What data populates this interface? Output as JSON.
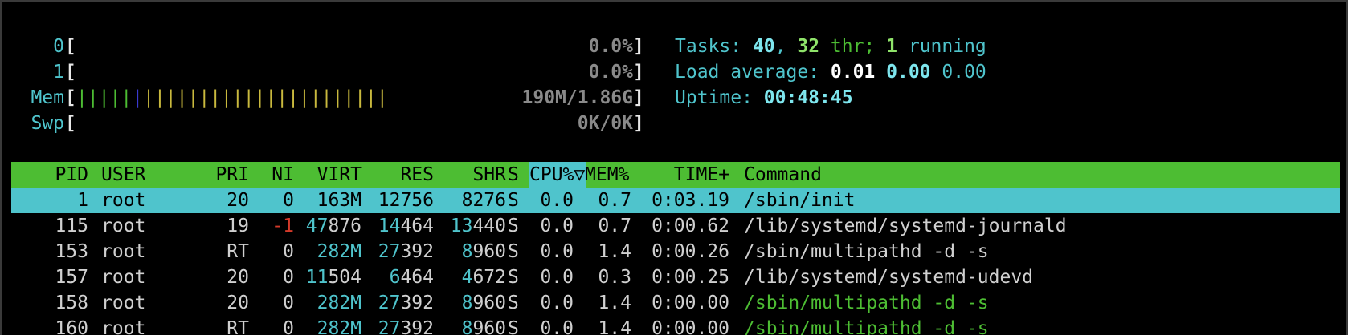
{
  "meters": {
    "cpu0": {
      "label": "0",
      "open": "[",
      "value": "0.0%",
      "close": "]"
    },
    "cpu1": {
      "label": "1",
      "open": "[",
      "value": "0.0%",
      "close": "]"
    },
    "mem": {
      "label": "Mem",
      "open": "[",
      "bars_green": "|||||",
      "bars_blue": "|",
      "bars_yellow": "||||||||||||||||||||||",
      "value": "190M/1.86G",
      "close": "]"
    },
    "swp": {
      "label": "Swp",
      "open": "[",
      "value": "0K/0K",
      "close": "]"
    }
  },
  "summary": {
    "tasks_label": "Tasks: ",
    "tasks_count": "40",
    "tasks_sep": ", ",
    "threads": "32",
    "threads_label": " thr; ",
    "running": "1",
    "running_label": " running",
    "load_label": "Load average: ",
    "load1": "0.01",
    "load5": "0.00",
    "load15": "0.00",
    "uptime_label": "Uptime: ",
    "uptime": "00:48:45"
  },
  "colors": {
    "header_bg": "#4dbd33",
    "selected_bg": "#4fc4cc",
    "cyan": "#4fc4cc",
    "green": "#4dbd33",
    "red": "#d53a2a",
    "yellow": "#c9b93e",
    "blue": "#3a3ad0"
  },
  "table": {
    "headers": {
      "pid": "PID",
      "user": "USER",
      "pri": "PRI",
      "ni": "NI",
      "virt": "VIRT",
      "res": "RES",
      "shr": "SHR",
      "s": "S",
      "cpu": "CPU%▽",
      "mem": "MEM%",
      "time": "TIME+",
      "command": "Command"
    },
    "rows": [
      {
        "pid": "1",
        "user": "root",
        "pri": "20",
        "ni": "0",
        "virt": "163M",
        "res": "12756",
        "shr": "8276",
        "s": "S",
        "cpu": "0.0",
        "mem": "0.7",
        "time": "0:03.19",
        "command": "/sbin/init"
      },
      {
        "pid": "115",
        "user": "root",
        "pri": "19",
        "ni": "-1",
        "virt": "47876",
        "res": "14464",
        "shr": "13440",
        "s": "S",
        "cpu": "0.0",
        "mem": "0.7",
        "time": "0:00.62",
        "command": "/lib/systemd/systemd-journald"
      },
      {
        "pid": "153",
        "user": "root",
        "pri": "RT",
        "ni": "0",
        "virt": "282M",
        "res": "27392",
        "shr": "8960",
        "s": "S",
        "cpu": "0.0",
        "mem": "1.4",
        "time": "0:00.26",
        "command": "/sbin/multipathd -d -s"
      },
      {
        "pid": "157",
        "user": "root",
        "pri": "20",
        "ni": "0",
        "virt": "11504",
        "res": "6464",
        "shr": "4672",
        "s": "S",
        "cpu": "0.0",
        "mem": "0.3",
        "time": "0:00.25",
        "command": "/lib/systemd/systemd-udevd"
      },
      {
        "pid": "158",
        "user": "root",
        "pri": "20",
        "ni": "0",
        "virt": "282M",
        "res": "27392",
        "shr": "8960",
        "s": "S",
        "cpu": "0.0",
        "mem": "1.4",
        "time": "0:00.00",
        "command": "/sbin/multipathd -d -s"
      },
      {
        "pid": "160",
        "user": "root",
        "pri": "RT",
        "ni": "0",
        "virt": "282M",
        "res": "27392",
        "shr": "8960",
        "s": "S",
        "cpu": "0.0",
        "mem": "1.4",
        "time": "0:00.00",
        "command": "/sbin/multipathd -d -s"
      }
    ]
  }
}
